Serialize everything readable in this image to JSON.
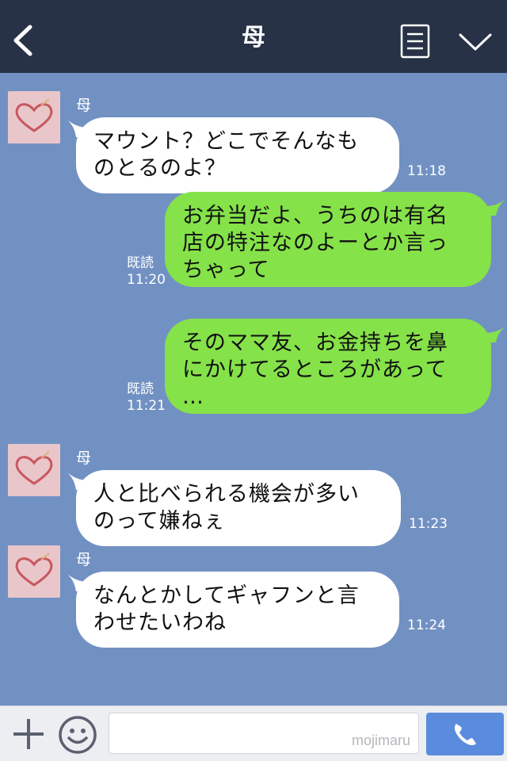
{
  "header": {
    "title": "母",
    "back_icon": "chevron-left-icon",
    "notes_icon": "note-list-icon",
    "menu_icon": "chevron-down-icon",
    "background": "#273246"
  },
  "messages": [
    {
      "direction": "incoming",
      "sender": "母",
      "text": "マウント？どこでそんなも\nのとるのよ？",
      "time": "11:18"
    },
    {
      "direction": "outgoing",
      "text": "お弁当だよ、うちのは有名\n店の特注なのよーとか言っ\nちゃって",
      "read": "既読",
      "time": "11:20"
    },
    {
      "direction": "outgoing",
      "text": "そのママ友、お金持ちを鼻\nにかけてるところがあって\n…",
      "read": "既読",
      "time": "11:21"
    },
    {
      "direction": "incoming",
      "sender": "母",
      "text": "人と比べられる機会が多い\nのって嫌ねぇ",
      "time": "11:23"
    },
    {
      "direction": "incoming",
      "sender": "母",
      "text": "なんとかしてギャフンと言\nわせたいわね",
      "time": "11:24"
    }
  ],
  "input_bar": {
    "watermark": "mojimaru",
    "plus_icon": "plus-icon",
    "emoji_icon": "smiley-icon",
    "call_icon": "phone-icon"
  },
  "colors": {
    "chat_background": "#7291c3",
    "outgoing_bubble": "#85e249",
    "incoming_bubble": "#ffffff",
    "call_button": "#5a8bdc"
  }
}
